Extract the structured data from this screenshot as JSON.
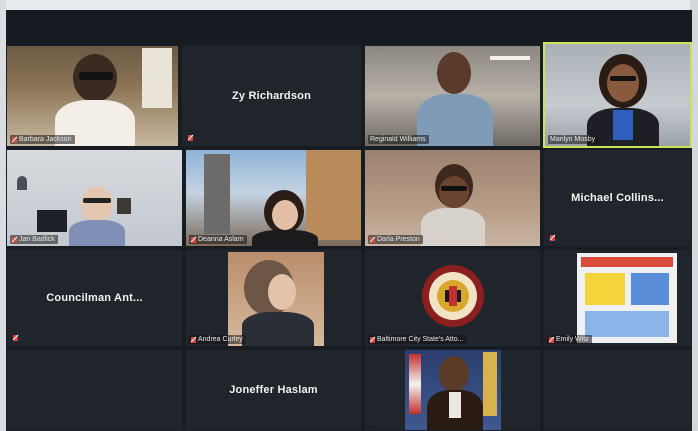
{
  "participants": [
    {
      "name": "Barbara Jackson",
      "muted": true
    },
    {
      "name": "Zy Richardson",
      "muted": true
    },
    {
      "name": "Reginald Williams",
      "muted": false
    },
    {
      "name": "Marilyn Mosby",
      "muted": false,
      "active_speaker": true
    },
    {
      "name": "Jan Badlick",
      "muted": true
    },
    {
      "name": "Deanna Aslam",
      "muted": true
    },
    {
      "name": "Darla Preston",
      "muted": true
    },
    {
      "name": "Michael Collins...",
      "muted": true
    },
    {
      "name": "Councilman Ant...",
      "muted": true
    },
    {
      "name": "Andrea Curley",
      "muted": true
    },
    {
      "name": "Baltimore City State's Atto...",
      "muted": true
    },
    {
      "name": "Emily Witz",
      "muted": true
    },
    {
      "name": "Joneffer Haslam",
      "muted": false
    },
    {
      "name": "",
      "muted": false
    }
  ],
  "colors": {
    "active_speaker_border": "#c9e35a",
    "muted_icon": "#e0453c",
    "tile_background": "#232830"
  }
}
